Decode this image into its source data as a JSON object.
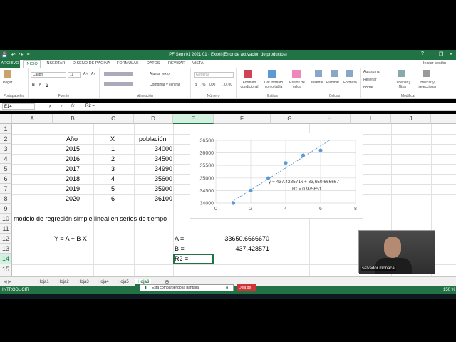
{
  "window": {
    "title": "PF Sem 01 2021 01  -  Excel (Error de activación de productos)",
    "controls": [
      "?",
      "─",
      "❐",
      "✕"
    ]
  },
  "qat": [
    "💾",
    "↶",
    "↷",
    "≡"
  ],
  "ribbon_tabs": {
    "file": "ARCHIVO",
    "tabs": [
      "INICIO",
      "INSERTAR",
      "DISEÑO DE PÁGINA",
      "FÓRMULAS",
      "DATOS",
      "REVISAR",
      "VISTA"
    ],
    "active_index": 0,
    "signin": "Iniciar sesión"
  },
  "ribbon": {
    "clipboard": {
      "label": "Portapapeles",
      "paste": "Pegar"
    },
    "font": {
      "label": "Fuente",
      "family": "Calibri",
      "size": "11",
      "bold": "N",
      "italic": "K",
      "underline": "S",
      "grow": "A˄",
      "shrink": "A˅"
    },
    "alignment": {
      "label": "Alineación",
      "wrap": "Ajustar texto",
      "merge": "Combinar y centrar"
    },
    "number": {
      "label": "Número",
      "format": "General",
      "currency": "$",
      "percent": "%",
      "thousands": "000",
      "inc_dec": "←0 .00"
    },
    "styles": {
      "label": "Estilos",
      "cond": "Formato condicional",
      "table": "Dar formato como tabla",
      "cell": "Estilos de celda"
    },
    "cells": {
      "label": "Celdas",
      "insert": "Insertar",
      "delete": "Eliminar",
      "format": "Formato"
    },
    "editing": {
      "label": "Modificar",
      "autosum": "Autosuma",
      "fill": "Rellenar",
      "clear": "Borrar",
      "sort": "Ordenar y filtrar",
      "find": "Buscar y seleccionar"
    }
  },
  "formula_bar": {
    "name_box": "E14",
    "fx": "fx",
    "cancel": "✕",
    "enter": "✓",
    "formula": "R2 ="
  },
  "columns": [
    "A",
    "B",
    "C",
    "D",
    "E",
    "F",
    "G",
    "H",
    "I",
    "J"
  ],
  "rows": [
    "1",
    "2",
    "3",
    "4",
    "5",
    "6",
    "7",
    "8",
    "9",
    "10",
    "11",
    "12",
    "13",
    "14",
    "15"
  ],
  "selected_column": "E",
  "selected_row": "14",
  "cells": {
    "header_anio": "Año",
    "header_x": "X",
    "header_poblacion": "población",
    "years": [
      "2015",
      "2016",
      "2017",
      "2018",
      "2019",
      "2020"
    ],
    "x_vals": [
      "1",
      "2",
      "3",
      "4",
      "5",
      "6"
    ],
    "poblacion": [
      "34000",
      "34500",
      "34990",
      "35600",
      "35900",
      "36100"
    ],
    "model_title": "modelo de regresión simple lineal en series de tiempo",
    "equation": "Y = A + B X",
    "label_a": "A =",
    "value_a": "33650.6666670",
    "label_b": "B =",
    "value_b": "437.428571",
    "label_r2": "R2 ="
  },
  "chart_data": {
    "type": "scatter",
    "x": [
      1,
      2,
      3,
      4,
      5,
      6
    ],
    "y": [
      34000,
      34500,
      34990,
      35600,
      35900,
      36100
    ],
    "xlim": [
      0,
      8
    ],
    "ylim": [
      34000,
      36500
    ],
    "x_ticks": [
      "0",
      "2",
      "4",
      "6",
      "8"
    ],
    "y_ticks": [
      "34000",
      "34500",
      "35000",
      "35500",
      "36000",
      "36500"
    ],
    "trendline": {
      "type": "linear",
      "intercept": 33650.666667,
      "slope": 437.428571,
      "equation_label": "y = 437.428571x + 33,650.666667",
      "r2_label": "R² = 0.975651"
    },
    "grid": true,
    "marker_color": "#5b9bd5",
    "trend_color": "#5b9bd5"
  },
  "video": {
    "person_name": "salvador monaca"
  },
  "sheets": {
    "tabs": [
      "Hoja1",
      "Hoja2",
      "Hoja3",
      "Hoja4",
      "Hoja5",
      "Hoja6"
    ],
    "active_index": 5,
    "add": "⊕"
  },
  "status": {
    "mode": "INTRODUCIR",
    "zoom": "150 %"
  },
  "share_bar": {
    "message": "Está compartiendo la pantalla",
    "stop": "Deja de"
  },
  "colors": {
    "excel_green": "#217346",
    "selection": "#d3f0e0"
  }
}
